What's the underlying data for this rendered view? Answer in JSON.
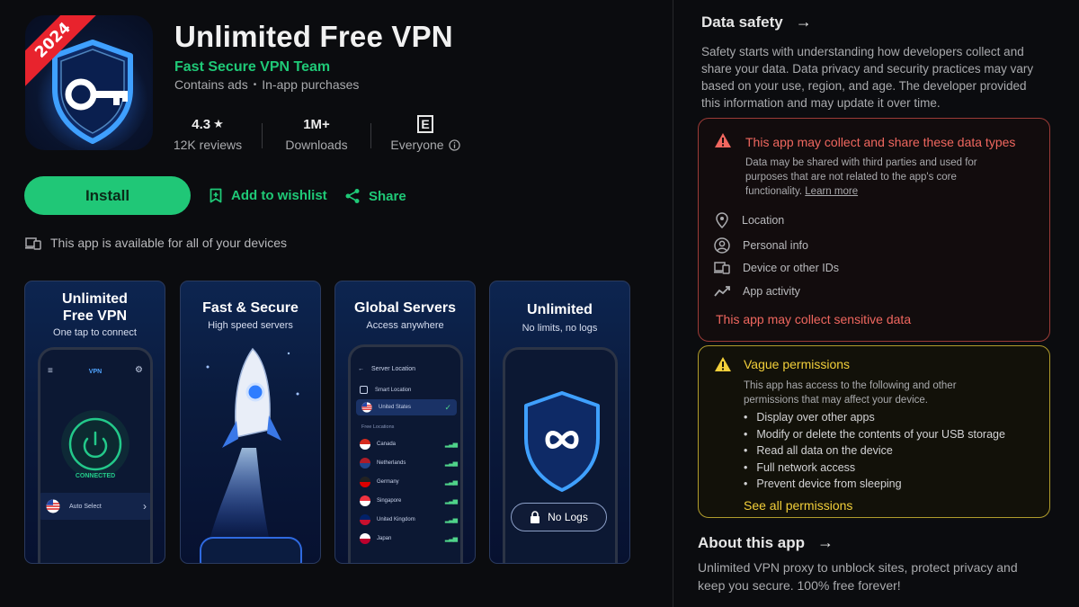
{
  "app": {
    "title": "Unlimited Free VPN",
    "developer": "Fast Secure VPN Team",
    "contains_ads": "Contains ads",
    "in_app": "In-app purchases",
    "icon_badge": "2024"
  },
  "stats": {
    "rating": "4.3",
    "rating_star": "★",
    "reviews": "12K reviews",
    "downloads_value": "1M+",
    "downloads_label": "Downloads",
    "content_rating_icon": "E",
    "content_rating": "Everyone"
  },
  "actions": {
    "install": "Install",
    "wishlist": "Add to wishlist",
    "share": "Share"
  },
  "devices_note": "This app is available for all of your devices",
  "screenshots": [
    {
      "heading_line1": "Unlimited",
      "heading_line2": "Free VPN",
      "sub": "One tap to connect",
      "phone_title": "VPN",
      "status": "CONNECTED",
      "select": "Auto Select"
    },
    {
      "heading": "Fast & Secure",
      "sub": "High speed servers"
    },
    {
      "heading": "Global Servers",
      "sub": "Access anywhere",
      "phone_title": "Server Location",
      "smart": "Smart Location",
      "selected": "United States",
      "free_label": "Free Locations",
      "servers": [
        "Canada",
        "Netherlands",
        "Germany",
        "Singapore",
        "United Kingdom",
        "Japan"
      ]
    },
    {
      "heading": "Unlimited",
      "sub": "No limits, no logs",
      "pill": "No Logs"
    }
  ],
  "data_safety": {
    "title": "Data safety",
    "body": "Safety starts with understanding how developers collect and share your data. Data privacy and security practices may vary based on your use, region, and age. The developer provided this information and may update it over time.",
    "warning_title": "This app may collect and share these data types",
    "warning_body": "Data may be shared with third parties and used for purposes that are not related to the app's core functionality.",
    "learn_more": "Learn more",
    "types": [
      "Location",
      "Personal info",
      "Device or other IDs",
      "App activity"
    ],
    "sensitive": "This app may collect sensitive data"
  },
  "permissions": {
    "title": "Vague permissions",
    "body": "This app has access to the following and other permissions that may affect your device.",
    "items": [
      "Display over other apps",
      "Modify or delete the contents of your USB storage",
      "Read all data on the device",
      "Full network access",
      "Prevent device from sleeping"
    ],
    "see_all": "See all permissions"
  },
  "about": {
    "title": "About this app",
    "body": "Unlimited VPN proxy to unblock sites, protect privacy and keep you secure. 100% free forever!"
  },
  "colors": {
    "accent_green": "#1fc977",
    "warning_red": "#f0675f",
    "warning_yellow": "#f2cf3a",
    "background": "#0b0c0f"
  }
}
